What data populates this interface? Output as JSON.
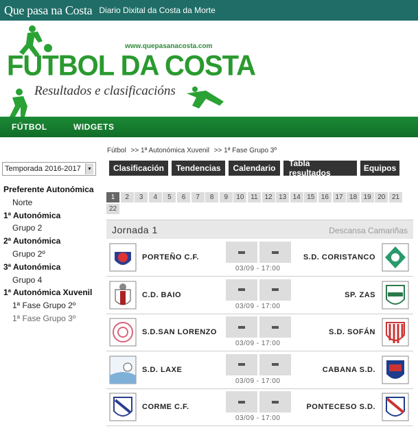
{
  "header": {
    "logo": "Que pasa na Costa",
    "tagline": "Diario Dixital da Costa da Morte"
  },
  "banner": {
    "url": "www.quepasanacosta.com",
    "title": "FUTBOL DA COSTA",
    "subtitle": "Resultados e clasificacións"
  },
  "nav": [
    "FÚTBOL",
    "WIDGETS"
  ],
  "breadcrumb": [
    "Fútbol",
    ">> 1ª Autonómica Xuvenil",
    ">> 1ª Fase Grupo 3º"
  ],
  "season": "Temporada 2016-2017",
  "menu": [
    {
      "group": "Preferente Autonómica",
      "items": [
        "Norte"
      ]
    },
    {
      "group": "1ª Autonómica",
      "items": [
        "Grupo 2"
      ]
    },
    {
      "group": "2ª Autonómica",
      "items": [
        "Grupo 2º"
      ]
    },
    {
      "group": "3ª Autonómica",
      "items": [
        "Grupo 4"
      ]
    },
    {
      "group": "1ª Autonómica Xuvenil",
      "items": [
        "1ª Fase Grupo 2º",
        "1ª Fase Grupo 3º"
      ]
    }
  ],
  "tabs": [
    "Clasificación",
    "Tendencias",
    "Calendario",
    "Tabla resultados",
    "Equipos"
  ],
  "rounds": [
    "1",
    "2",
    "3",
    "4",
    "5",
    "6",
    "7",
    "8",
    "9",
    "10",
    "11",
    "12",
    "13",
    "14",
    "15",
    "16",
    "17",
    "18",
    "19",
    "20",
    "21",
    "22"
  ],
  "active_round": "1",
  "jornada": {
    "label": "Jornada 1",
    "rest": "Descansa Camariñas"
  },
  "matches": [
    {
      "home": "PORTEÑO C.F.",
      "away": "S.D. CORISTANCO",
      "time": "03/09 - 17:00"
    },
    {
      "home": "C.D. BAIO",
      "away": "SP. ZAS",
      "time": "03/09 - 17:00"
    },
    {
      "home": "S.D.SAN LORENZO",
      "away": "S.D. SOFÁN",
      "time": "03/09 - 17:00"
    },
    {
      "home": "S.D. LAXE",
      "away": "CABANA S.D.",
      "time": "03/09 - 17:00"
    },
    {
      "home": "CORME C.F.",
      "away": "PONTECESO S.D.",
      "time": "03/09 - 17:00"
    }
  ],
  "colors": {
    "topbar": "#1f6d66",
    "nav": "#17812f",
    "brand_green": "#2a9a2f",
    "tab": "#333333"
  }
}
